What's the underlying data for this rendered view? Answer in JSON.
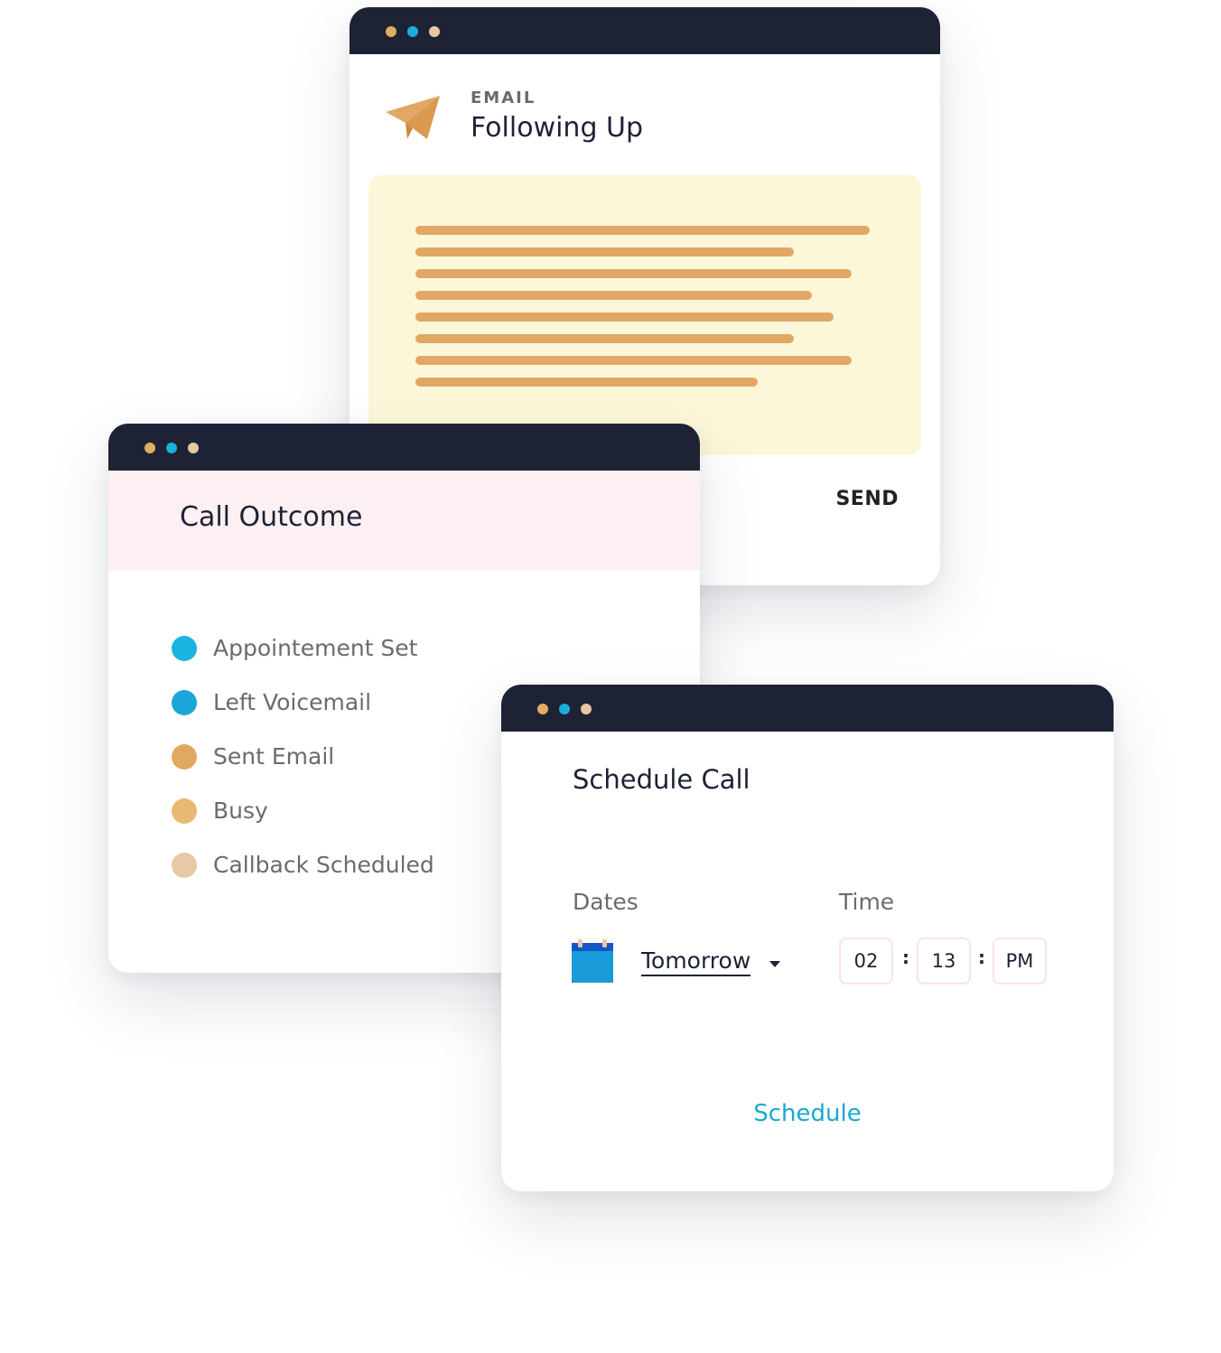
{
  "colors": {
    "titlebar": "#1e2235",
    "dot_orange": "#e3ad5f",
    "dot_blue": "#19aede",
    "dot_beige": "#e8c7a0",
    "email_body_bg": "#fdf7d9",
    "email_lines": "#e0a864",
    "call_header_bg": "#fdf0f2",
    "schedule_link": "#18a9d0"
  },
  "email_window": {
    "icon": "paper-plane-icon",
    "eyebrow": "EMAIL",
    "title": "Following Up",
    "send_label": "SEND"
  },
  "call_window": {
    "title": "Call Outcome",
    "outcomes": [
      {
        "label": "Appointement Set",
        "color": "#19b4e0"
      },
      {
        "label": "Left Voicemail",
        "color": "#1aa6d8"
      },
      {
        "label": "Sent Email",
        "color": "#e1a862"
      },
      {
        "label": "Busy",
        "color": "#e8b974"
      },
      {
        "label": "Callback Scheduled",
        "color": "#e6c9a6"
      }
    ]
  },
  "schedule_window": {
    "title": "Schedule Call",
    "dates_label": "Dates",
    "time_label": "Time",
    "date_icon": "calendar-icon",
    "date_value": "Tomorrow",
    "hour": "02",
    "minute": "13",
    "meridiem": "PM",
    "separator": ":",
    "schedule_label": "Schedule"
  }
}
